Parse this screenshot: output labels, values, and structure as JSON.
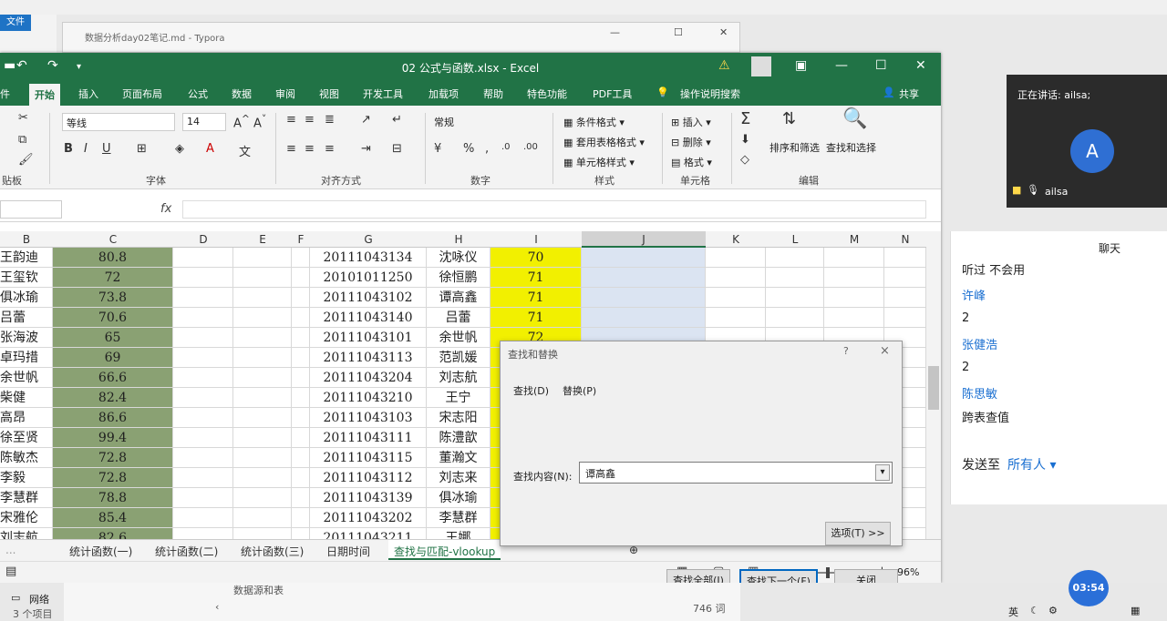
{
  "explorer": {
    "file_menu": "文件",
    "status_network": "网络",
    "item_count": "3 个项目"
  },
  "typora": {
    "title": "数据分析day02笔记.md - Typora",
    "preview_text": "数据源和表",
    "word_count": "746 词"
  },
  "excel": {
    "title": "02 公式与函数.xlsx  -  Excel",
    "tabs": [
      "开始",
      "插入",
      "页面布局",
      "公式",
      "数据",
      "审阅",
      "视图",
      "开发工具",
      "加载项",
      "帮助",
      "特色功能",
      "PDF工具"
    ],
    "file_tab": "件",
    "tell_me": "操作说明搜索",
    "share": "共享",
    "ribbon": {
      "font_name": "等线",
      "font_size": "14",
      "number_format": "常规",
      "cond_format": "条件格式",
      "table_format": "套用表格格式",
      "cell_style": "单元格样式",
      "insert": "插入",
      "delete": "删除",
      "format": "格式",
      "sort_filter": "排序和筛选",
      "find_select": "查找和选择",
      "groups": {
        "clipboard": "贴板",
        "font": "字体",
        "align": "对齐方式",
        "number": "数字",
        "styles": "样式",
        "cells": "单元格",
        "editing": "编辑"
      }
    },
    "columns": [
      "B",
      "C",
      "D",
      "E",
      "F",
      "G",
      "H",
      "I",
      "J",
      "K",
      "L",
      "M",
      "N"
    ],
    "rows": [
      {
        "b": "王韵迪",
        "c": "80.8",
        "g": "20111043134",
        "h": "沈咏仪",
        "i": "70"
      },
      {
        "b": "王玺钦",
        "c": "72",
        "g": "20101011250",
        "h": "徐恒鹏",
        "i": "71"
      },
      {
        "b": "俱冰瑜",
        "c": "73.8",
        "g": "20111043102",
        "h": "谭高鑫",
        "i": "71"
      },
      {
        "b": "吕蕾",
        "c": "70.6",
        "g": "20111043140",
        "h": "吕蕾",
        "i": "71"
      },
      {
        "b": "张海波",
        "c": "65",
        "g": "20111043101",
        "h": "余世帆",
        "i": "72"
      },
      {
        "b": "卓玛措",
        "c": "69",
        "g": "20111043113",
        "h": "范凯媛",
        "i": ""
      },
      {
        "b": "余世帆",
        "c": "66.6",
        "g": "20111043204",
        "h": "刘志航",
        "i": ""
      },
      {
        "b": "柴健",
        "c": "82.4",
        "g": "20111043210",
        "h": "王宁",
        "i": ""
      },
      {
        "b": "高昂",
        "c": "86.6",
        "g": "20111043103",
        "h": "宋志阳",
        "i": ""
      },
      {
        "b": "徐至贤",
        "c": "99.4",
        "g": "20111043111",
        "h": "陈澧歆",
        "i": ""
      },
      {
        "b": "陈敏杰",
        "c": "72.8",
        "g": "20111043115",
        "h": "董瀚文",
        "i": ""
      },
      {
        "b": "李毅",
        "c": "72.8",
        "g": "20111043112",
        "h": "刘志来",
        "i": ""
      },
      {
        "b": "李慧群",
        "c": "78.8",
        "g": "20111043139",
        "h": "俱冰瑜",
        "i": ""
      },
      {
        "b": "宋雅伦",
        "c": "85.4",
        "g": "20111043202",
        "h": "李慧群",
        "i": ""
      },
      {
        "b": "刘志航",
        "c": "82.6",
        "g": "20111043211",
        "h": "王娜",
        "i": ""
      }
    ],
    "sheets": [
      "统计函数(一)",
      "统计函数(二)",
      "统计函数(三)",
      "日期时间",
      "查找与匹配-vlookup"
    ],
    "active_sheet": "查找与匹配-vlookup",
    "zoom": "96%"
  },
  "dialog": {
    "title": "查找和替换",
    "tab_find": "查找(D)",
    "tab_replace": "替换(P)",
    "find_label": "查找内容(N):",
    "find_value": "谭高鑫",
    "options": "选项(T) >>",
    "find_all": "查找全部(I)",
    "find_next": "查找下一个(F)",
    "close": "关闭",
    "help": "?",
    "close_x": "×"
  },
  "meeting": {
    "speaking": "正在讲话: ailsa;",
    "avatar_letter": "A",
    "user": "ailsa"
  },
  "chat": {
    "title": "聊天",
    "messages": [
      {
        "text": "听过 不会用",
        "kind": "msg"
      },
      {
        "text": "许峰",
        "kind": "name"
      },
      {
        "text": "2",
        "kind": "msg"
      },
      {
        "text": "张健浩",
        "kind": "name"
      },
      {
        "text": "2",
        "kind": "msg"
      },
      {
        "text": "陈思敏",
        "kind": "name"
      },
      {
        "text": "跨表查值",
        "kind": "msg"
      }
    ],
    "send_to_label": "发送至",
    "send_to_value": "所有人"
  },
  "taskbar": {
    "time": "03:54",
    "ime": "英"
  }
}
